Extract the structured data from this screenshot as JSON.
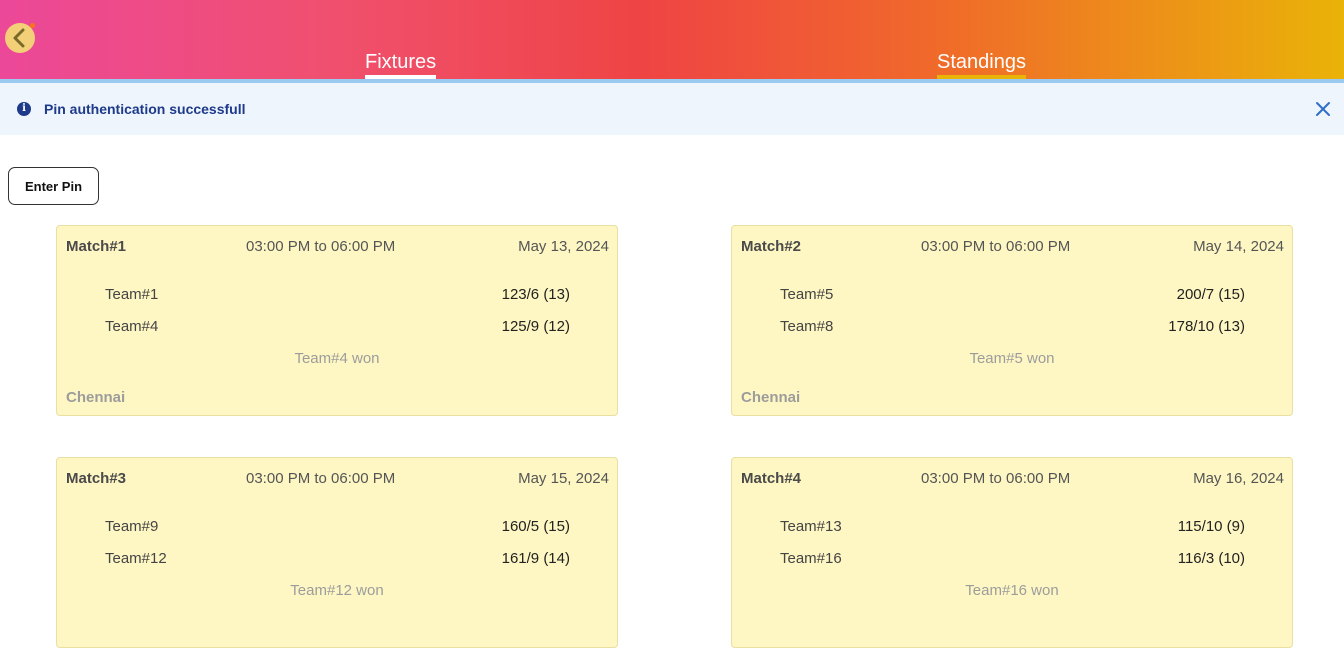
{
  "header": {
    "tabs": [
      {
        "label": "Fixtures"
      },
      {
        "label": "Standings"
      }
    ]
  },
  "alert": {
    "message": "Pin authentication successfull"
  },
  "enter_pin_label": "Enter Pin",
  "matches": [
    {
      "title": "Match#1",
      "time": "03:00 PM to 06:00 PM",
      "date": "May 13, 2024",
      "team1": "Team#1",
      "score1": "123/6 (13)",
      "team2": "Team#4",
      "score2": "125/9 (12)",
      "result": "Team#4 won",
      "venue": "Chennai"
    },
    {
      "title": "Match#2",
      "time": "03:00 PM to 06:00 PM",
      "date": "May 14, 2024",
      "team1": "Team#5",
      "score1": "200/7 (15)",
      "team2": "Team#8",
      "score2": "178/10 (13)",
      "result": "Team#5 won",
      "venue": "Chennai"
    },
    {
      "title": "Match#3",
      "time": "03:00 PM to 06:00 PM",
      "date": "May 15, 2024",
      "team1": "Team#9",
      "score1": "160/5 (15)",
      "team2": "Team#12",
      "score2": "161/9 (14)",
      "result": "Team#12 won",
      "venue": ""
    },
    {
      "title": "Match#4",
      "time": "03:00 PM to 06:00 PM",
      "date": "May 16, 2024",
      "team1": "Team#13",
      "score1": "115/10 (9)",
      "team2": "Team#16",
      "score2": "116/3 (10)",
      "result": "Team#16 won",
      "venue": ""
    }
  ],
  "colors": {
    "card_background": "#fef7c3",
    "alert_text": "#1e3a8a",
    "alert_background": "#eef5fd",
    "standings_underline": "#eab308"
  },
  "icons": {
    "back": "chevron-left-icon",
    "info": "info-icon",
    "close": "close-icon"
  }
}
